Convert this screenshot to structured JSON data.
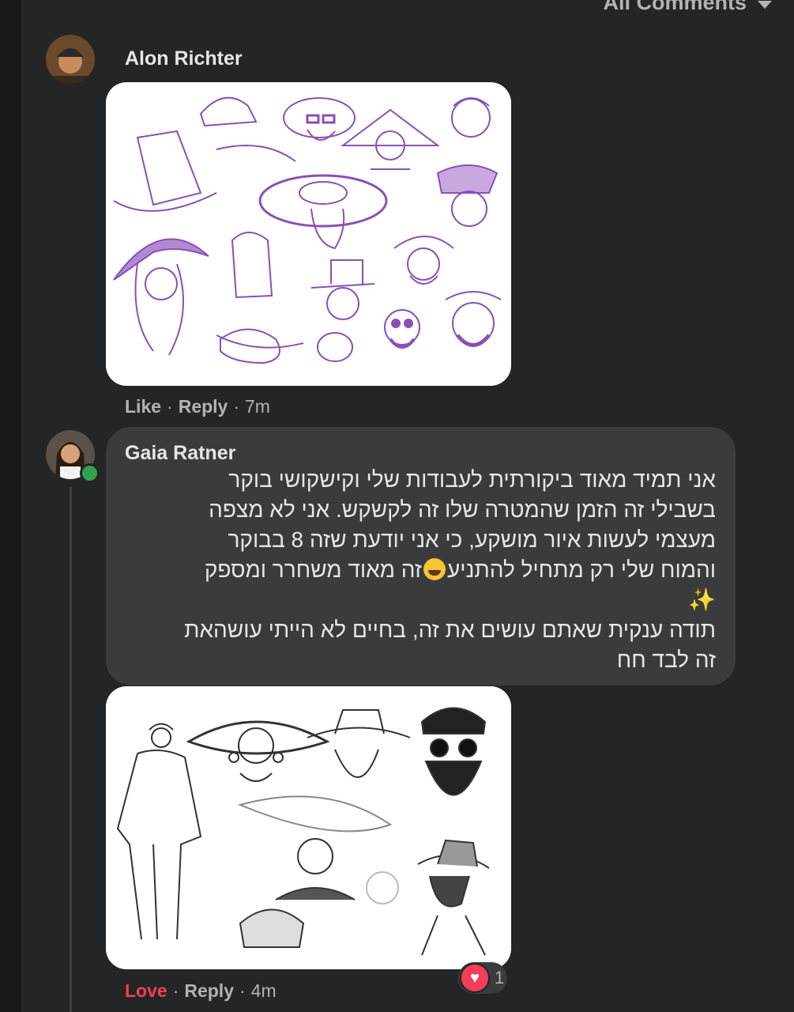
{
  "header": {
    "sort_label": "All Comments"
  },
  "comments": [
    {
      "author": "Alon Richter",
      "actions": {
        "like": "Like",
        "reply": "Reply",
        "time": "7m"
      }
    },
    {
      "author": "Gaia Ratner",
      "text_lines": [
        "אני תמיד מאוד ביקורתית לעבודות שלי וקישקושי בוקר",
        "בשבילי זה הזמן שהמטרה שלו זה לקשקש. אני לא מצפה",
        "מעצמי לעשות איור מושקע, כי אני יודעת שזה 8 בבוקר",
        "והמוח שלי רק מתחיל להתניע",
        "זה מאוד משחרר ומספק",
        "✨",
        "תודה ענקית שאתם עושים את זה, בחיים לא הייתי עושהאת",
        "זה לבד חח"
      ],
      "actions": {
        "like": "Love",
        "reply": "Reply",
        "time": "4m"
      },
      "reaction_count": "1"
    }
  ],
  "colors": {
    "love": "#f33e58",
    "online": "#31a24c",
    "sketch_purple": "#8a4fb8"
  },
  "icons": [
    "caret-down-icon",
    "heart-reaction-icon",
    "online-status-icon"
  ]
}
